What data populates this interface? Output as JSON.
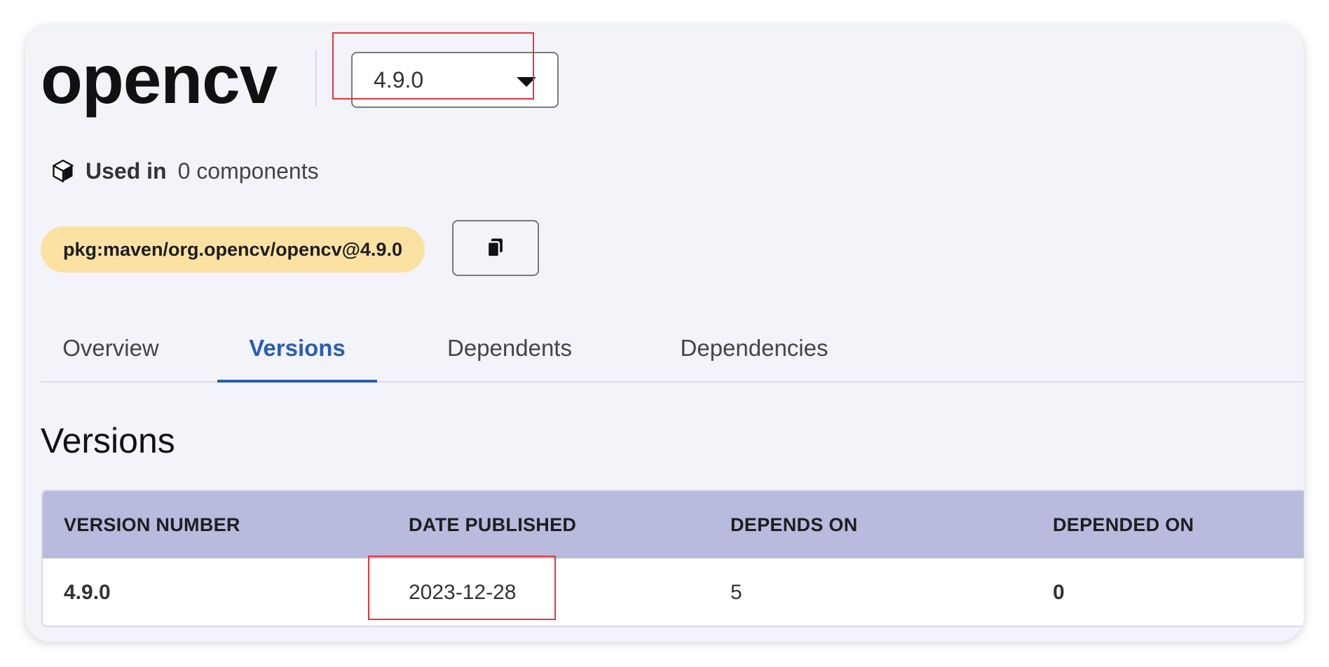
{
  "package": {
    "name": "opencv",
    "selected_version": "4.9.0",
    "used_in_label": "Used in",
    "used_in_value": "0 components",
    "purl": "pkg:maven/org.opencv/opencv@4.9.0"
  },
  "tabs": [
    {
      "label": "Overview",
      "active": false
    },
    {
      "label": "Versions",
      "active": true
    },
    {
      "label": "Dependents",
      "active": false
    },
    {
      "label": "Dependencies",
      "active": false
    }
  ],
  "section": {
    "title": "Versions"
  },
  "table": {
    "headers": [
      "VERSION NUMBER",
      "DATE PUBLISHED",
      "DEPENDS ON",
      "DEPENDED ON"
    ],
    "rows": [
      {
        "version": "4.9.0",
        "date": "2023-12-28",
        "depends_on": "5",
        "depended_on": "0"
      }
    ]
  },
  "icons": {
    "used_in": "cube-icon",
    "copy": "copy-icon",
    "dropdown": "caret-down-icon"
  },
  "colors": {
    "card_background": "#f3f4f9",
    "accent": "#2a5cb8",
    "purl_badge": "#fbe2a3",
    "table_header": "#b8bade",
    "highlight": "#e8353d"
  }
}
